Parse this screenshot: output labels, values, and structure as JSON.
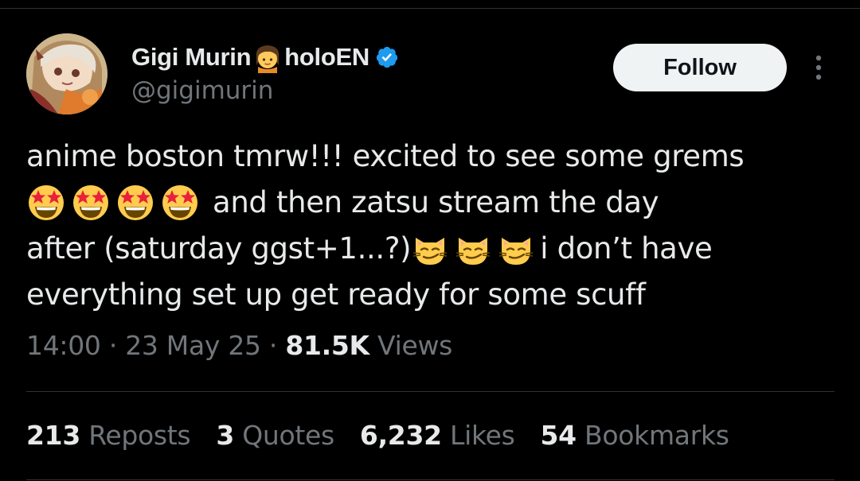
{
  "author": {
    "display_name": "Gigi Murin",
    "name_emoji": "girl-emoji",
    "name_suffix": "holoEN",
    "handle": "@gigimurin",
    "verified_icon": "verified-badge-icon",
    "verified_color": "#1d9bf0"
  },
  "actions": {
    "follow_label": "Follow",
    "more_icon": "more-vertical-icon"
  },
  "tweet": {
    "line1": "anime boston tmrw!!! excited to see some grems",
    "line2_emoji": "star-struck-emoji",
    "line2_text": "and then zatsu stream the day",
    "line3_text_a": "after (saturday ggst+1...?)",
    "line3_emoji": "smirking-cat-emoji",
    "line3_text_b": "i don’t have",
    "line4": "everything set up get ready for some scuff"
  },
  "meta": {
    "time": "14:00",
    "sep1": "·",
    "date": "23 May 25",
    "sep2": "·",
    "views_count": "81.5K",
    "views_label": "Views"
  },
  "stats": {
    "reposts_count": "213",
    "reposts_label": "Reposts",
    "quotes_count": "3",
    "quotes_label": "Quotes",
    "likes_count": "6,232",
    "likes_label": "Likes",
    "bookmarks_count": "54",
    "bookmarks_label": "Bookmarks"
  },
  "colors": {
    "background": "#000000",
    "text_primary": "#e7e9ea",
    "text_secondary": "#71767b",
    "divider": "#2f3336",
    "button_bg": "#eff3f4"
  }
}
